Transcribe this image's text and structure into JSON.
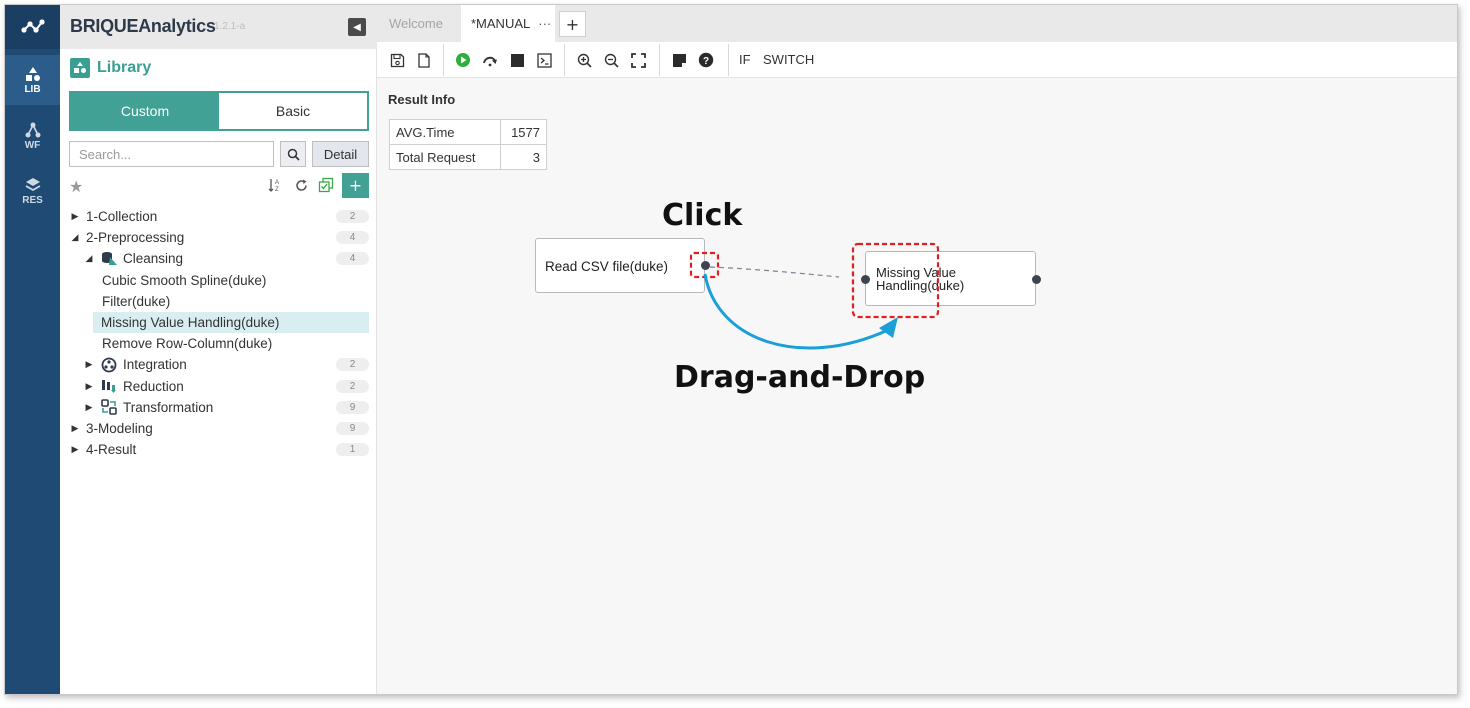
{
  "app": {
    "brand": "BRIQUEAnalytics",
    "version": "1.2.1-a"
  },
  "rail": {
    "items": [
      {
        "label": "LIB",
        "icon": "shapes-icon"
      },
      {
        "label": "WF",
        "icon": "workflow-icon"
      },
      {
        "label": "RES",
        "icon": "layers-icon"
      }
    ]
  },
  "library": {
    "title": "Library",
    "tabs": {
      "custom": "Custom",
      "basic": "Basic"
    },
    "search_placeholder": "Search...",
    "detail_label": "Detail",
    "add_label": "+",
    "tree": [
      {
        "label": "1-Collection",
        "count": "2"
      },
      {
        "label": "2-Preprocessing",
        "count": "4"
      },
      {
        "label": "Cleansing",
        "count": "4"
      },
      {
        "label": "Cubic Smooth Spline(duke)"
      },
      {
        "label": "Filter(duke)"
      },
      {
        "label": "Missing Value Handling(duke)"
      },
      {
        "label": "Remove Row-Column(duke)"
      },
      {
        "label": "Integration",
        "count": "2"
      },
      {
        "label": "Reduction",
        "count": "2"
      },
      {
        "label": "Transformation",
        "count": "9"
      },
      {
        "label": "3-Modeling",
        "count": "9"
      },
      {
        "label": "4-Result",
        "count": "1"
      }
    ]
  },
  "tabs": {
    "welcome": "Welcome",
    "manual": "*MANUAL",
    "manual_menu": "···",
    "add": "+"
  },
  "toolbar": {
    "if_label": "IF",
    "switch_label": "SWITCH"
  },
  "result": {
    "title": "Result Info",
    "rows": [
      {
        "key": "AVG.Time",
        "value": "1577"
      },
      {
        "key": "Total Request",
        "value": "3"
      }
    ]
  },
  "nodes": {
    "read_csv": "Read CSV file(duke)",
    "missing_value_line1": "Missing Value",
    "missing_value_line2": "Handling(duke)"
  },
  "annotations": {
    "click": "Click",
    "drag": "Drag-and-Drop"
  },
  "colors": {
    "accent": "#42a195",
    "rail": "#1f4a73",
    "highlight": "#d8eef0",
    "annotation_red": "#e02020",
    "annotation_blue": "#1a9fd8"
  }
}
